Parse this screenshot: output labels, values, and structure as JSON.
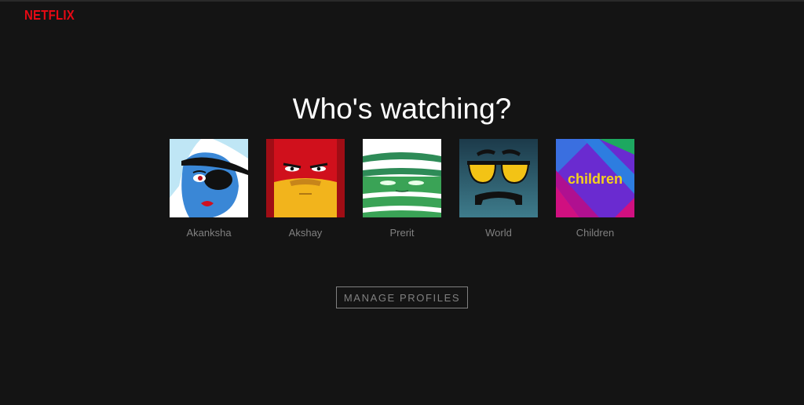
{
  "brand": {
    "logo_text": "NETFLIX",
    "color": "#e50914"
  },
  "page": {
    "title": "Who's watching?"
  },
  "profiles": [
    {
      "name": "Akanksha",
      "icon": "pirate-eyepatch-avatar-icon"
    },
    {
      "name": "Akshay",
      "icon": "red-yellow-angry-face-avatar-icon"
    },
    {
      "name": "Prerit",
      "icon": "green-mummy-face-avatar-icon"
    },
    {
      "name": "World",
      "icon": "sunglasses-mustache-avatar-icon"
    },
    {
      "name": "Children",
      "icon": "children-avatar-icon",
      "avatar_text": "children"
    }
  ],
  "actions": {
    "manage_label": "MANAGE PROFILES"
  },
  "colors": {
    "background": "#141414",
    "text_muted": "#808080",
    "title": "#ffffff"
  }
}
